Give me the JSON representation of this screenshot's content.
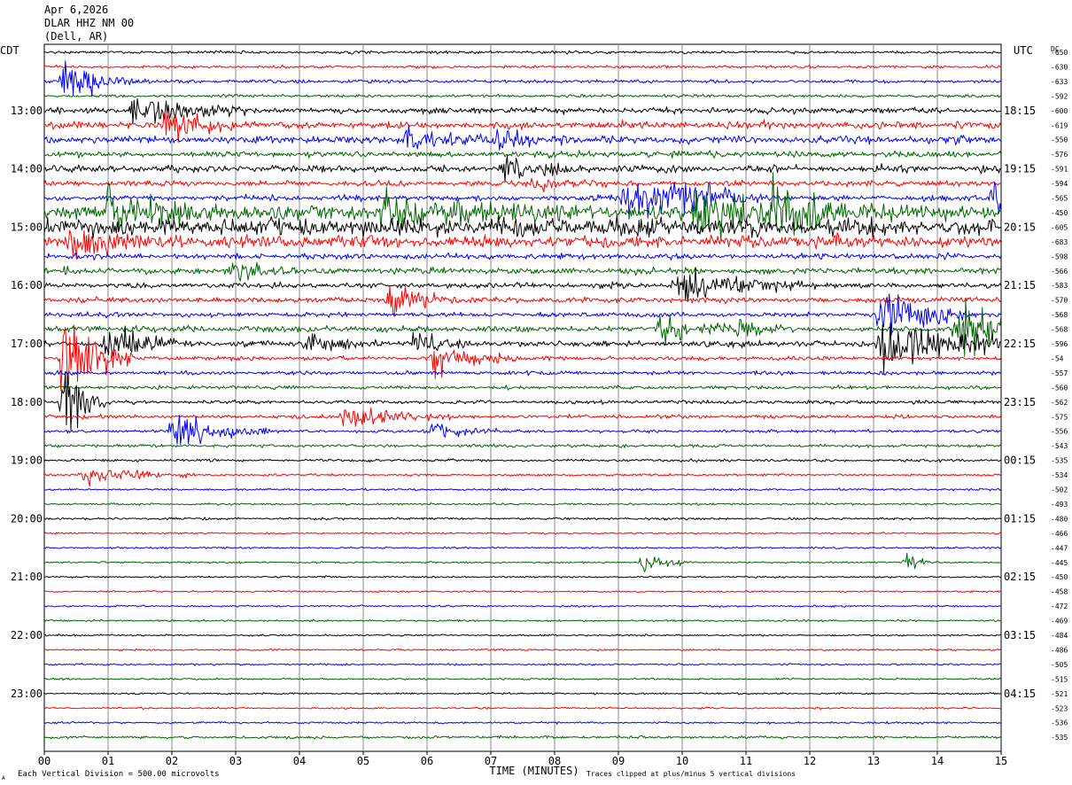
{
  "header": {
    "date": "Apr 6,2026",
    "station": "DLAR HHZ NM 00",
    "location": "(Dell, AR)"
  },
  "axes": {
    "left_label": "CDT",
    "right_label": "UTC",
    "dc_label": "DC",
    "xlabel": "TIME (MINUTES)",
    "x_ticks": [
      "00",
      "01",
      "02",
      "03",
      "04",
      "05",
      "06",
      "07",
      "08",
      "09",
      "10",
      "11",
      "12",
      "13",
      "14",
      "15"
    ],
    "left_hours": [
      "13:00",
      "14:00",
      "15:00",
      "16:00",
      "17:00",
      "18:00",
      "19:00",
      "20:00",
      "21:00",
      "22:00",
      "23:00"
    ],
    "right_hours": [
      "18:15",
      "19:15",
      "20:15",
      "21:15",
      "22:15",
      "23:15",
      "00:15",
      "01:15",
      "02:15",
      "03:15",
      "04:15"
    ]
  },
  "footer": {
    "scale_note": "Each Vertical Division =  500.00 microvolts",
    "clip_note": "Traces clipped at plus/minus 5 vertical divisions",
    "corner_mark": "A"
  },
  "colors": {
    "trace_cycle": [
      "#000000",
      "#ff0000",
      "#0000ff",
      "#006400"
    ],
    "grid": "#888888"
  },
  "chart_data": {
    "type": "line",
    "title": "DLAR HHZ NM 00",
    "x_unit": "minutes",
    "xlim": [
      0,
      15
    ],
    "traces_per_hour": 4,
    "trace_duration_min": 15,
    "dc_offsets": [
      -650,
      -630,
      -633,
      -592,
      -600,
      -619,
      -550,
      -576,
      -591,
      -594,
      -565,
      -450,
      -605,
      -683,
      -598,
      -566,
      -583,
      -570,
      -568,
      -568,
      -596,
      -54,
      -557,
      -560,
      -562,
      -575,
      -556,
      -543,
      -535,
      -534,
      -502,
      -493,
      -480,
      -466,
      -447,
      -445,
      -450,
      -458,
      -472,
      -469,
      -484,
      -486,
      -505,
      -515,
      -521,
      -523,
      -536,
      -535
    ],
    "trace_activity": [
      1,
      1,
      1.1,
      1,
      2,
      2.5,
      2.5,
      2,
      2.5,
      1.8,
      2,
      5,
      6,
      4,
      2,
      2.2,
      1.8,
      1.8,
      1.6,
      2,
      2,
      1.4,
      1.3,
      1.2,
      1.2,
      1.2,
      1,
      1,
      0.9,
      0.8,
      0.7,
      0.7,
      0.8,
      0.6,
      0.6,
      0.6,
      0.6,
      0.6,
      0.6,
      0.6,
      0.6,
      0.6,
      0.6,
      0.6,
      0.6,
      0.6,
      0.7,
      0.9
    ],
    "events": [
      {
        "trace": 2,
        "minute": 0.3,
        "amp": 14,
        "duration": 0.3
      },
      {
        "trace": 2,
        "minute": 0.6,
        "amp": 8,
        "duration": 0.5
      },
      {
        "trace": 4,
        "minute": 1.4,
        "amp": 12,
        "duration": 0.8
      },
      {
        "trace": 5,
        "minute": 1.9,
        "amp": 14,
        "duration": 0.5
      },
      {
        "trace": 6,
        "minute": 5.7,
        "amp": 8,
        "duration": 0.6
      },
      {
        "trace": 6,
        "minute": 7.1,
        "amp": 8,
        "duration": 0.5
      },
      {
        "trace": 8,
        "minute": 7.2,
        "amp": 8,
        "duration": 0.5
      },
      {
        "trace": 9,
        "minute": 7.6,
        "amp": 6,
        "duration": 0.6
      },
      {
        "trace": 10,
        "minute": 9.1,
        "amp": 18,
        "duration": 0.8
      },
      {
        "trace": 10,
        "minute": 9.9,
        "amp": 12,
        "duration": 0.8
      },
      {
        "trace": 10,
        "minute": 14.9,
        "amp": 20,
        "duration": 0.4
      },
      {
        "trace": 11,
        "minute": 1.0,
        "amp": 14,
        "duration": 0.8
      },
      {
        "trace": 11,
        "minute": 5.3,
        "amp": 16,
        "duration": 1.0
      },
      {
        "trace": 11,
        "minute": 10.2,
        "amp": 18,
        "duration": 1.0
      },
      {
        "trace": 11,
        "minute": 11.4,
        "amp": 16,
        "duration": 0.8
      },
      {
        "trace": 13,
        "minute": 0.4,
        "amp": 12,
        "duration": 0.6
      },
      {
        "trace": 15,
        "minute": 2.9,
        "amp": 8,
        "duration": 0.5
      },
      {
        "trace": 16,
        "minute": 9.9,
        "amp": 14,
        "duration": 1.0
      },
      {
        "trace": 17,
        "minute": 5.4,
        "amp": 12,
        "duration": 0.5
      },
      {
        "trace": 19,
        "minute": 9.6,
        "amp": 10,
        "duration": 0.6
      },
      {
        "trace": 19,
        "minute": 10.9,
        "amp": 10,
        "duration": 0.4
      },
      {
        "trace": 19,
        "minute": 14.3,
        "amp": 20,
        "duration": 1.0
      },
      {
        "trace": 18,
        "minute": 13.1,
        "amp": 22,
        "duration": 0.7
      },
      {
        "trace": 20,
        "minute": 1.0,
        "amp": 14,
        "duration": 0.6
      },
      {
        "trace": 20,
        "minute": 4.1,
        "amp": 12,
        "duration": 0.5
      },
      {
        "trace": 20,
        "minute": 5.8,
        "amp": 10,
        "duration": 0.4
      },
      {
        "trace": 20,
        "minute": 13.1,
        "amp": 28,
        "duration": 1.0
      },
      {
        "trace": 21,
        "minute": 0.3,
        "amp": 40,
        "duration": 0.5
      },
      {
        "trace": 21,
        "minute": 6.1,
        "amp": 14,
        "duration": 0.6
      },
      {
        "trace": 24,
        "minute": 0.3,
        "amp": 30,
        "duration": 0.3
      },
      {
        "trace": 25,
        "minute": 4.7,
        "amp": 10,
        "duration": 0.8
      },
      {
        "trace": 26,
        "minute": 2.0,
        "amp": 14,
        "duration": 0.7
      },
      {
        "trace": 26,
        "minute": 6.1,
        "amp": 6,
        "duration": 0.5
      },
      {
        "trace": 29,
        "minute": 0.6,
        "amp": 8,
        "duration": 0.8
      },
      {
        "trace": 35,
        "minute": 9.4,
        "amp": 9,
        "duration": 0.3
      },
      {
        "trace": 35,
        "minute": 13.5,
        "amp": 9,
        "duration": 0.2
      }
    ]
  }
}
